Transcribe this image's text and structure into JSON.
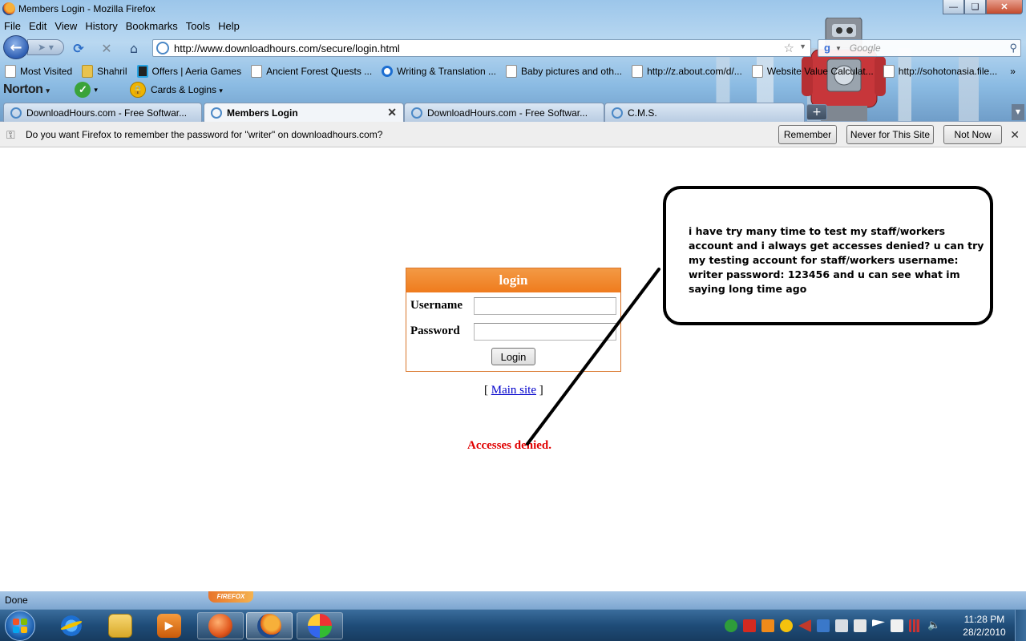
{
  "window": {
    "title": "Members Login - Mozilla Firefox"
  },
  "menu": [
    "File",
    "Edit",
    "View",
    "History",
    "Bookmarks",
    "Tools",
    "Help"
  ],
  "navigation": {
    "url": "http://www.downloadhours.com/secure/login.html",
    "search_placeholder": "Google"
  },
  "bookmarks": [
    {
      "label": "Most Visited",
      "icon": "page-icon"
    },
    {
      "label": "Shahril",
      "icon": "folder-icon"
    },
    {
      "label": "Offers | Aeria Games",
      "icon": "aeria-icon"
    },
    {
      "label": "Ancient Forest Quests ...",
      "icon": "page-icon"
    },
    {
      "label": "Writing & Translation ...",
      "icon": "circle-icon"
    },
    {
      "label": "Baby pictures and oth...",
      "icon": "page-icon"
    },
    {
      "label": "http://z.about.com/d/...",
      "icon": "page-icon"
    },
    {
      "label": "Website Value Calculat...",
      "icon": "page-icon"
    },
    {
      "label": "http://sohotonasia.file...",
      "icon": "page-icon"
    }
  ],
  "norton": {
    "logo": "Norton",
    "cards": "Cards & Logins"
  },
  "tabs": [
    {
      "label": "DownloadHours.com - Free Softwar...",
      "active": false
    },
    {
      "label": "Members Login",
      "active": true
    },
    {
      "label": "DownloadHours.com - Free Softwar...",
      "active": false
    },
    {
      "label": "C.M.S.",
      "active": false
    }
  ],
  "password_prompt": {
    "message": "Do you want Firefox to remember the password for \"writer\" on downloadhours.com?",
    "remember": "Remember",
    "never": "Never for This Site",
    "not_now": "Not Now"
  },
  "login": {
    "heading": "login",
    "username_label": "Username",
    "password_label": "Password",
    "button": "Login",
    "main_site_prefix": "[",
    "main_site_link": "Main site",
    "main_site_suffix": "]",
    "error": "Accesses denied."
  },
  "callout": {
    "text": "i have try many time to test my staff/workers account and i always get accesses denied? u can try my testing account for staff/workers username: writer password: 123456 and u can see what im saying long time ago"
  },
  "status": {
    "text": "Done",
    "badge": "FIREFOX"
  },
  "taskbar": {
    "clock_time": "11:28 PM",
    "clock_date": "28/2/2010"
  },
  "colors": {
    "login_header": "#ef7b1d",
    "error_red": "#e00000",
    "link_blue": "#0000cc"
  }
}
